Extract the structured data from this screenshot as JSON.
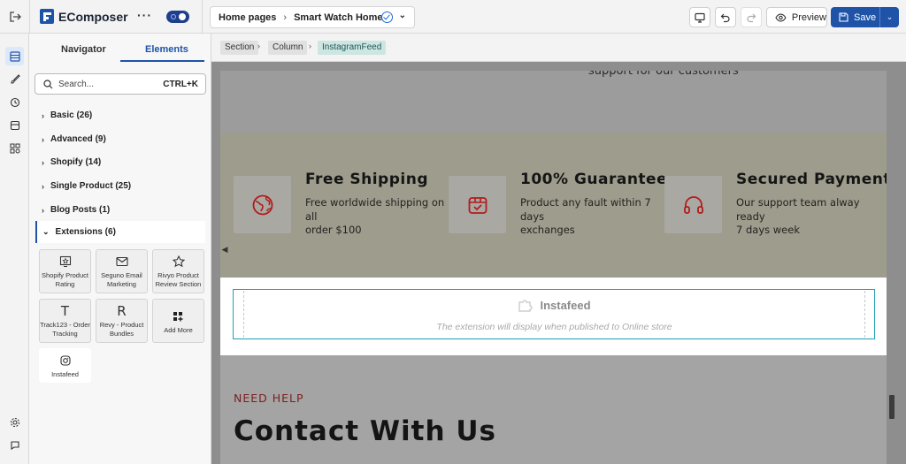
{
  "app": {
    "brand": "EComposer",
    "page_selector": {
      "section": "Home pages",
      "page": "Smart Watch Home"
    },
    "actions": {
      "preview": "Preview",
      "save": "Save"
    }
  },
  "sidebar": {
    "tabs": [
      "Navigator",
      "Elements"
    ],
    "active_tab": "Elements",
    "search": {
      "placeholder": "Search...",
      "shortcut": "CTRL+K"
    },
    "categories": [
      {
        "label": "Basic (26)"
      },
      {
        "label": "Advanced (9)"
      },
      {
        "label": "Shopify (14)"
      },
      {
        "label": "Single Product (25)"
      },
      {
        "label": "Blog Posts (1)"
      }
    ],
    "open_category": "Extensions (6)",
    "extensions": [
      {
        "label": "Shopify Product Rating",
        "icon": "rating-icon"
      },
      {
        "label": "Seguno Email Marketing",
        "icon": "mail-icon"
      },
      {
        "label": "Rivyo Product Review Section",
        "icon": "star-icon"
      },
      {
        "label": "Track123 - Order Tracking",
        "icon": "text-T-icon"
      },
      {
        "label": "Revy - Product Bundles",
        "icon": "text-R-icon"
      },
      {
        "label": "Add More",
        "icon": "grid-add-icon"
      },
      {
        "label": "Instafeed",
        "icon": "instagram-icon"
      }
    ]
  },
  "breadcrumb": [
    "Section",
    "Column",
    "InstagramFeed"
  ],
  "canvas": {
    "cut_text": "support for our customers",
    "features": [
      {
        "title": "Free Shipping",
        "desc": [
          "Free worldwide shipping on",
          "all",
          "order $100"
        ],
        "icon": "globe-icon"
      },
      {
        "title": "100% Guarantee",
        "desc": [
          "Product any fault within 7",
          "days",
          "exchanges"
        ],
        "icon": "box-check-icon"
      },
      {
        "title": "Secured Payment",
        "desc": [
          "Our support team alway",
          "ready",
          "7 days week"
        ],
        "icon": "headphones-icon"
      }
    ],
    "instafeed": {
      "title": "Instafeed",
      "subtitle": "The extension will display when published to Online store"
    },
    "need_help": "NEED HELP",
    "contact": "Contact With Us"
  },
  "colors": {
    "accent": "#1f53a8",
    "toggle": "#1f3f8c",
    "feature_icon": "#b01c1c",
    "selection": "#1fa0b8"
  }
}
